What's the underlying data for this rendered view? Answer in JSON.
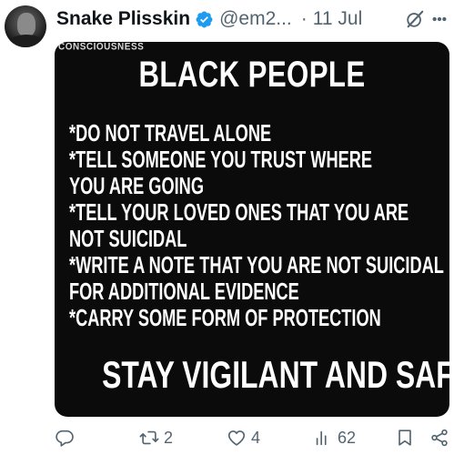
{
  "tweet": {
    "author_name": "Snake Plisskin",
    "handle": "@em2...",
    "separator": "·",
    "date": "11 Jul"
  },
  "media": {
    "watermark_top": "",
    "watermark": "CONSCIOUSNESS",
    "title": "BLACK PEOPLE",
    "lines": [
      "*DO NOT TRAVEL ALONE",
      "*TELL SOMEONE YOU TRUST WHERE",
      "YOU ARE GOING",
      "*TELL YOUR LOVED ONES THAT YOU ARE",
      "NOT SUICIDAL",
      "*WRITE A NOTE THAT YOU ARE NOT SUICIDAL",
      "FOR ADDITIONAL EVIDENCE",
      "*CARRY SOME FORM OF PROTECTION"
    ],
    "footer": "STAY VIGILANT AND SAFE"
  },
  "actions": {
    "replies": "",
    "retweets": "2",
    "likes": "4",
    "views": "62"
  },
  "colors": {
    "verified_blue": "#1d9bf0",
    "secondary_text": "#536471",
    "image_background": "#0b0b0b"
  },
  "icons": [
    "verified-badge-icon",
    "grok-icon",
    "more-icon",
    "reply-icon",
    "retweet-icon",
    "like-icon",
    "views-icon",
    "bookmark-icon",
    "share-icon"
  ]
}
